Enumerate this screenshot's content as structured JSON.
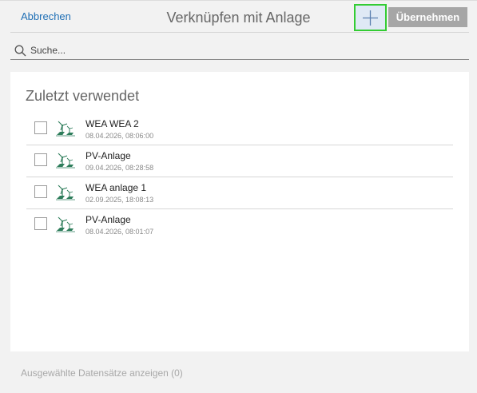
{
  "header": {
    "cancel_label": "Abbrechen",
    "title": "Verknüpfen mit Anlage",
    "apply_label": "Übernehmen"
  },
  "search": {
    "placeholder": "Suche..."
  },
  "recent": {
    "title": "Zuletzt verwendet",
    "items": [
      {
        "name": "WEA WEA 2",
        "date": "08.04.2026, 08:06:00",
        "checked": false
      },
      {
        "name": "PV-Anlage",
        "date": "09.04.2026, 08:28:58",
        "checked": false
      },
      {
        "name": "WEA anlage 1",
        "date": "02.09.2025, 18:08:13",
        "checked": false
      },
      {
        "name": "PV-Anlage",
        "date": "08.04.2026, 08:01:07",
        "checked": false
      }
    ]
  },
  "footer": {
    "show_selected_label": "Ausgewählte Datensätze anzeigen (0)"
  },
  "icons": {
    "add": "plus-icon",
    "search": "search-icon",
    "item": "wind-solar-plant-icon"
  },
  "colors": {
    "link": "#1f6fb5",
    "highlight_border": "#33cc33",
    "apply_bg": "#a6a6a6",
    "icon_green": "#2e7d5b"
  }
}
